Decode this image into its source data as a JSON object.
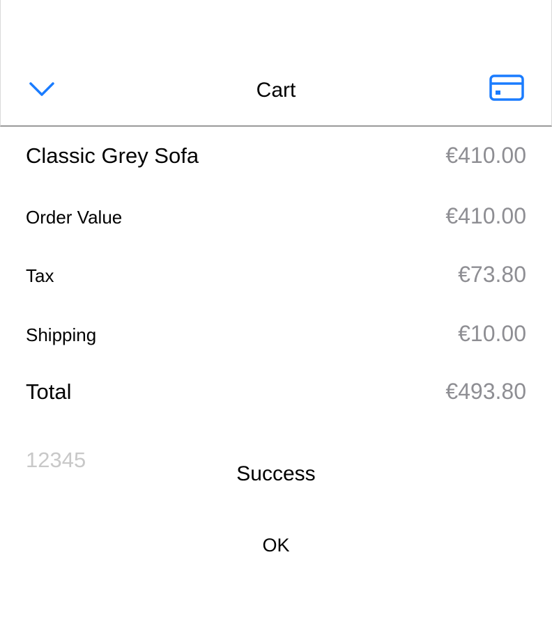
{
  "header": {
    "title": "Cart",
    "collapse_icon": "chevron-down-icon",
    "card_icon": "credit-card-icon",
    "accent_color": "#1a7cff"
  },
  "cart": {
    "product": {
      "label": "Classic Grey Sofa",
      "price": "€410.00"
    },
    "order_value": {
      "label": "Order Value",
      "value": "€410.00"
    },
    "tax": {
      "label": "Tax",
      "value": "€73.80"
    },
    "shipping": {
      "label": "Shipping",
      "value": "€10.00"
    },
    "total": {
      "label": "Total",
      "value": "€493.80"
    }
  },
  "code_input": {
    "placeholder": "12345"
  },
  "alert": {
    "title": "Success",
    "ok_label": "OK"
  }
}
